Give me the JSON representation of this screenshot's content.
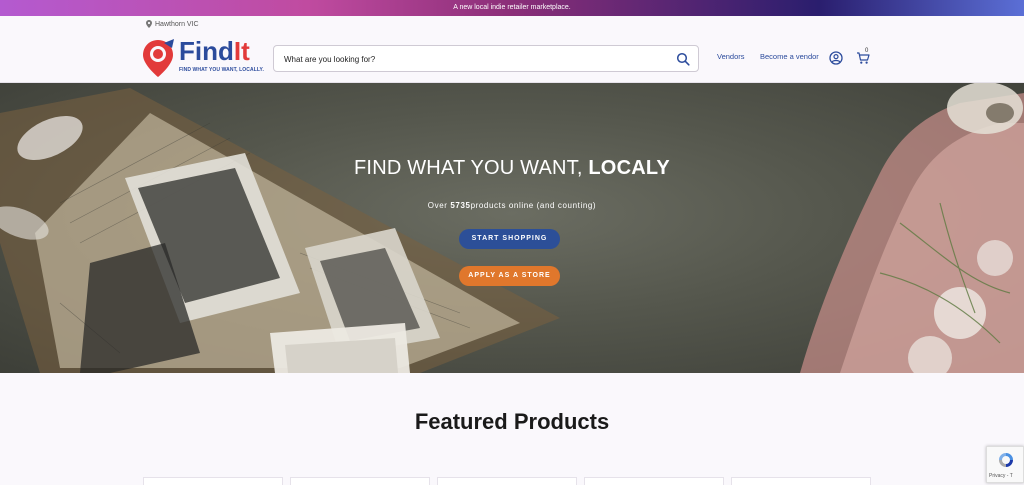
{
  "announcement": "A new local indie retailer marketplace.",
  "location": "Hawthorn VIC",
  "logo": {
    "word_main": "Find",
    "word_accent": "It",
    "tagline": "FIND WHAT YOU WANT, LOCALLY."
  },
  "search": {
    "placeholder": "What are you looking for?"
  },
  "nav": {
    "vendors": "Vendors",
    "become_vendor": "Become a vendor",
    "cart_count": "0"
  },
  "hero": {
    "title_main": "FIND WHAT YOU WANT, ",
    "title_bold": "LOCALY",
    "sub_prefix": "Over ",
    "product_count": "5735",
    "sub_suffix": "products online (and counting)",
    "start_label": "START SHOPPING",
    "apply_label": "APPLY AS A STORE"
  },
  "featured": {
    "title": "Featured Products"
  },
  "recaptcha": {
    "text": "Privacy - T"
  },
  "colors": {
    "brand_blue": "#2b4b9c",
    "brand_red": "#e23a3a",
    "button_blue": "#2c4f98",
    "button_orange": "#e0772c"
  }
}
